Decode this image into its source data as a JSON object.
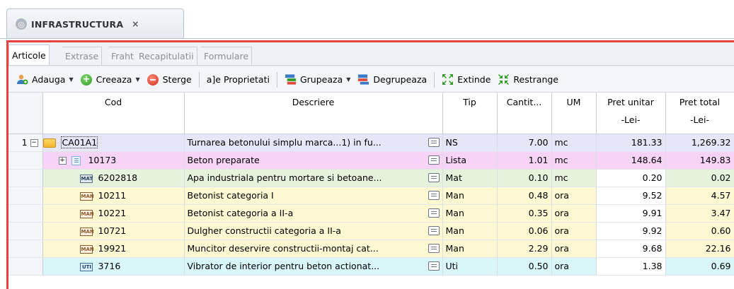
{
  "document_tab": {
    "title": "INFRASTRUCTURA",
    "close": "×"
  },
  "tabs": [
    "Articole",
    "Extrase",
    "Fraht",
    "Recapitulatii",
    "Formulare"
  ],
  "toolbar": {
    "adauga": "Adauga",
    "creeaza": "Creeaza",
    "sterge": "Sterge",
    "proprietati": "Proprietati",
    "grupeaza": "Grupeaza",
    "degrupeaza": "Degrupeaza",
    "extinde": "Extinde",
    "restrange": "Restrange"
  },
  "columns": {
    "cod": "Cod",
    "descriere": "Descriere",
    "tip": "Tip",
    "cantitate": "Cantit...",
    "um": "UM",
    "pret_unitar": "Pret unitar",
    "pret_total": "Pret total",
    "currency": "-Lei-"
  },
  "rows": [
    {
      "index": "1",
      "expander": "−",
      "cod": "CA01A1",
      "descriere": "Turnarea betonului simplu marca...1) in fu...",
      "tip": "NS",
      "cantitate": "7.00",
      "um": "mc",
      "pret_unitar": "181.33",
      "pret_total": "1,269.32"
    },
    {
      "index": "",
      "expander": "+",
      "cod": "10173",
      "descriere": "Beton preparate",
      "tip": "Lista",
      "cantitate": "1.01",
      "um": "mc",
      "pret_unitar": "148.64",
      "pret_total": "149.83"
    },
    {
      "index": "",
      "cod": "6202818",
      "descriere": "Apa industriala pentru mortare si betoane...",
      "tip": "Mat",
      "cantitate": "0.10",
      "um": "mc",
      "pret_unitar": "0.20",
      "pret_total": "0.02"
    },
    {
      "index": "",
      "cod": "10211",
      "descriere": "Betonist categoria I",
      "tip": "Man",
      "cantitate": "0.48",
      "um": "ora",
      "pret_unitar": "9.52",
      "pret_total": "4.57"
    },
    {
      "index": "",
      "cod": "10221",
      "descriere": "Betonist categoria a II-a",
      "tip": "Man",
      "cantitate": "0.35",
      "um": "ora",
      "pret_unitar": "9.91",
      "pret_total": "3.47"
    },
    {
      "index": "",
      "cod": "10721",
      "descriere": "Dulgher constructii categoria a II-a",
      "tip": "Man",
      "cantitate": "0.06",
      "um": "ora",
      "pret_unitar": "9.92",
      "pret_total": "0.60"
    },
    {
      "index": "",
      "cod": "19921",
      "descriere": "Muncitor deservire constructii-montaj cat...",
      "tip": "Man",
      "cantitate": "2.29",
      "um": "ora",
      "pret_unitar": "9.68",
      "pret_total": "22.16"
    },
    {
      "index": "",
      "cod": "3716",
      "descriere": "Vibrator de interior pentru beton actionat...",
      "tip": "Uti",
      "cantitate": "0.50",
      "um": "ora",
      "pret_unitar": "1.38",
      "pret_total": "0.69"
    }
  ],
  "colors": {
    "active_border": "#e8413a",
    "root_row": "#e5e7f8",
    "list_row": "#f7d3f7",
    "mat_row": "#e6f3dc",
    "man_row": "#fbf8d2",
    "uti_row": "#d9f6f9"
  }
}
